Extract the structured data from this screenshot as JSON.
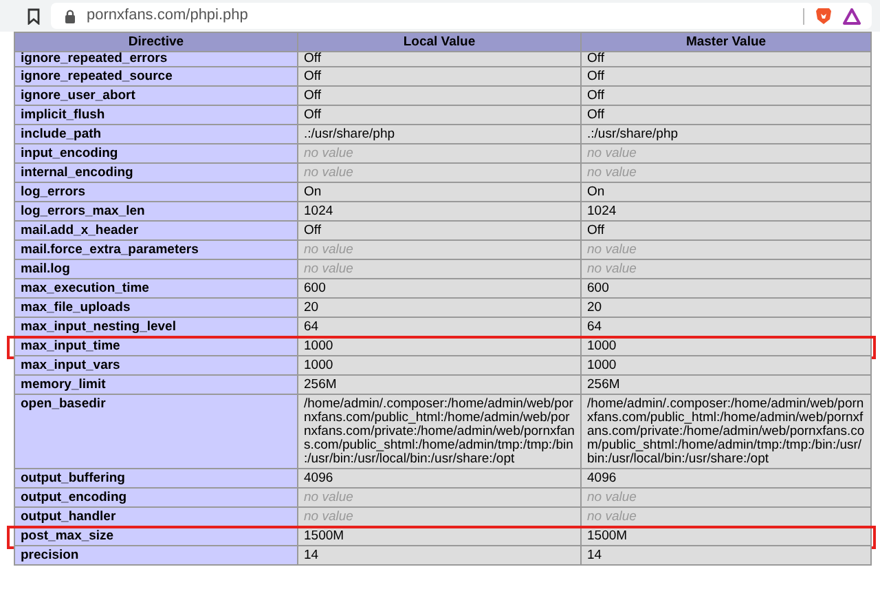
{
  "browser": {
    "url": "pornxfans.com/phpi.php"
  },
  "table": {
    "columns": [
      "Directive",
      "Local Value",
      "Master Value"
    ],
    "rows": [
      {
        "directive": "ignore_repeated_errors",
        "local": {
          "text": "Off",
          "kind": "value"
        },
        "master": {
          "text": "Off",
          "kind": "value"
        },
        "highlighted": false
      },
      {
        "directive": "ignore_repeated_source",
        "local": {
          "text": "Off",
          "kind": "value"
        },
        "master": {
          "text": "Off",
          "kind": "value"
        },
        "highlighted": false
      },
      {
        "directive": "ignore_user_abort",
        "local": {
          "text": "Off",
          "kind": "value"
        },
        "master": {
          "text": "Off",
          "kind": "value"
        },
        "highlighted": false
      },
      {
        "directive": "implicit_flush",
        "local": {
          "text": "Off",
          "kind": "value"
        },
        "master": {
          "text": "Off",
          "kind": "value"
        },
        "highlighted": false
      },
      {
        "directive": "include_path",
        "local": {
          "text": ".:/usr/share/php",
          "kind": "value"
        },
        "master": {
          "text": ".:/usr/share/php",
          "kind": "value"
        },
        "highlighted": false
      },
      {
        "directive": "input_encoding",
        "local": {
          "text": "no value",
          "kind": "none"
        },
        "master": {
          "text": "no value",
          "kind": "none"
        },
        "highlighted": false
      },
      {
        "directive": "internal_encoding",
        "local": {
          "text": "no value",
          "kind": "none"
        },
        "master": {
          "text": "no value",
          "kind": "none"
        },
        "highlighted": false
      },
      {
        "directive": "log_errors",
        "local": {
          "text": "On",
          "kind": "value"
        },
        "master": {
          "text": "On",
          "kind": "value"
        },
        "highlighted": false
      },
      {
        "directive": "log_errors_max_len",
        "local": {
          "text": "1024",
          "kind": "value"
        },
        "master": {
          "text": "1024",
          "kind": "value"
        },
        "highlighted": false
      },
      {
        "directive": "mail.add_x_header",
        "local": {
          "text": "Off",
          "kind": "value"
        },
        "master": {
          "text": "Off",
          "kind": "value"
        },
        "highlighted": false
      },
      {
        "directive": "mail.force_extra_parameters",
        "local": {
          "text": "no value",
          "kind": "none"
        },
        "master": {
          "text": "no value",
          "kind": "none"
        },
        "highlighted": false
      },
      {
        "directive": "mail.log",
        "local": {
          "text": "no value",
          "kind": "none"
        },
        "master": {
          "text": "no value",
          "kind": "none"
        },
        "highlighted": false
      },
      {
        "directive": "max_execution_time",
        "local": {
          "text": "600",
          "kind": "value"
        },
        "master": {
          "text": "600",
          "kind": "value"
        },
        "highlighted": false
      },
      {
        "directive": "max_file_uploads",
        "local": {
          "text": "20",
          "kind": "value"
        },
        "master": {
          "text": "20",
          "kind": "value"
        },
        "highlighted": false
      },
      {
        "directive": "max_input_nesting_level",
        "local": {
          "text": "64",
          "kind": "value"
        },
        "master": {
          "text": "64",
          "kind": "value"
        },
        "highlighted": false
      },
      {
        "directive": "max_input_time",
        "local": {
          "text": "1000",
          "kind": "value"
        },
        "master": {
          "text": "1000",
          "kind": "value"
        },
        "highlighted": true
      },
      {
        "directive": "max_input_vars",
        "local": {
          "text": "1000",
          "kind": "value"
        },
        "master": {
          "text": "1000",
          "kind": "value"
        },
        "highlighted": false
      },
      {
        "directive": "memory_limit",
        "local": {
          "text": "256M",
          "kind": "value"
        },
        "master": {
          "text": "256M",
          "kind": "value"
        },
        "highlighted": false
      },
      {
        "directive": "open_basedir",
        "local": {
          "text": "/home/admin/.composer:/home/admin/web/pornxfans.com/public_html:/home/admin/web/pornxfans.com/private:/home/admin/web/pornxfans.com/public_shtml:/home/admin/tmp:/tmp:/bin:/usr/bin:/usr/local/bin:/usr/share:/opt",
          "kind": "value"
        },
        "master": {
          "text": "/home/admin/.composer:/home/admin/web/pornxfans.com/public_html:/home/admin/web/pornxfans.com/private:/home/admin/web/pornxfans.com/public_shtml:/home/admin/tmp:/tmp:/bin:/usr/bin:/usr/local/bin:/usr/share:/opt",
          "kind": "value"
        },
        "highlighted": false
      },
      {
        "directive": "output_buffering",
        "local": {
          "text": "4096",
          "kind": "value"
        },
        "master": {
          "text": "4096",
          "kind": "value"
        },
        "highlighted": false
      },
      {
        "directive": "output_encoding",
        "local": {
          "text": "no value",
          "kind": "none"
        },
        "master": {
          "text": "no value",
          "kind": "none"
        },
        "highlighted": false
      },
      {
        "directive": "output_handler",
        "local": {
          "text": "no value",
          "kind": "none"
        },
        "master": {
          "text": "no value",
          "kind": "none"
        },
        "highlighted": false
      },
      {
        "directive": "post_max_size",
        "local": {
          "text": "1500M",
          "kind": "value"
        },
        "master": {
          "text": "1500M",
          "kind": "value"
        },
        "highlighted": true
      },
      {
        "directive": "precision",
        "local": {
          "text": "14",
          "kind": "value"
        },
        "master": {
          "text": "14",
          "kind": "value"
        },
        "highlighted": false
      }
    ]
  }
}
